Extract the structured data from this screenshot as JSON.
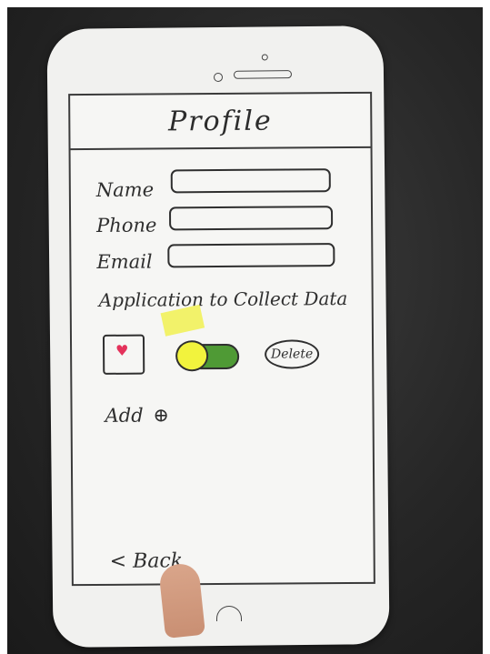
{
  "screen": {
    "title": "Profile"
  },
  "form": {
    "name_label": "Name",
    "phone_label": "Phone",
    "email_label": "Email",
    "name_value": "",
    "phone_value": "",
    "email_value": ""
  },
  "apps_section": {
    "title": "Application to Collect Data",
    "app_icon": "heart-icon",
    "toggle_on": true,
    "delete_label": "Delete"
  },
  "add": {
    "label": "Add",
    "icon_glyph": "⊕"
  },
  "nav": {
    "back_label": "< Back"
  },
  "colors": {
    "heart": "#e4325b",
    "toggle_track": "#4f9a35",
    "toggle_knob": "#f2f33d"
  }
}
